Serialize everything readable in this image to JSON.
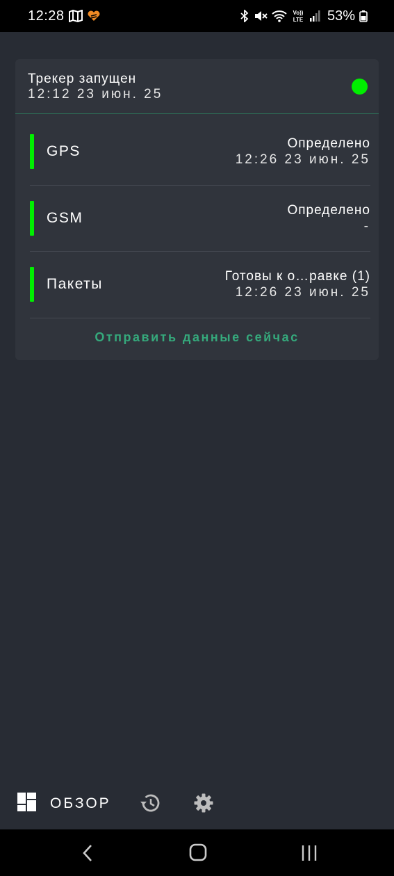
{
  "status_bar": {
    "time": "12:28",
    "battery": "53%",
    "left_icons": [
      "map-icon",
      "app-notification-icon"
    ],
    "right_icons": [
      "bluetooth-icon",
      "mute-icon",
      "wifi-icon",
      "volte-icon",
      "signal-icon",
      "battery-icon"
    ]
  },
  "tracker": {
    "title": "Трекер запущен",
    "started": "12:12 23 июн. 25",
    "indicator_color": "#00ee00"
  },
  "rows": [
    {
      "label": "GPS",
      "status": "Определено",
      "time": "12:26 23 июн. 25"
    },
    {
      "label": "GSM",
      "status": "Определено",
      "time": "-"
    },
    {
      "label": "Пакеты",
      "status": "Готовы к о…равке (1)",
      "time": "12:26 23 июн. 25"
    }
  ],
  "send_now_label": "Отправить данные сейчас",
  "bottom_nav": {
    "overview_label": "ОБЗОР",
    "icons": [
      "dashboard-icon",
      "history-icon",
      "settings-icon"
    ]
  },
  "colors": {
    "background": "#282c34",
    "card": "#30343c",
    "accent_green": "#00ee00",
    "button_text": "#35a97c"
  }
}
